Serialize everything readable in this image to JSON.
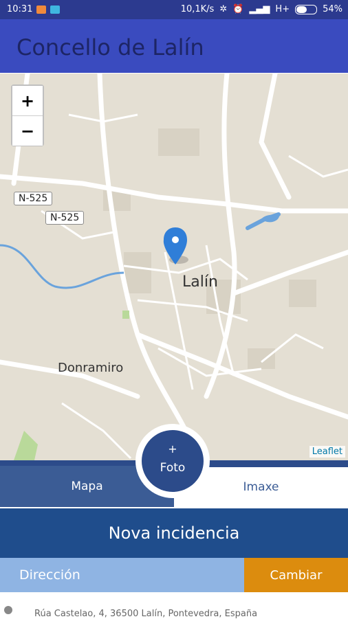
{
  "status_bar": {
    "time": "10:31",
    "net_speed": "10,1K/s",
    "network": "H+",
    "battery_percent": "54%",
    "battery_level": 0.54
  },
  "app_bar": {
    "title": "Concello de Lalín"
  },
  "map": {
    "zoom_in": "+",
    "zoom_out": "−",
    "road_labels": [
      "N-525",
      "N-525"
    ],
    "places": {
      "city": "Lalín",
      "village": "Donramiro"
    },
    "attribution": "Leaflet",
    "marker_icon": "map-marker-icon"
  },
  "tabs": {
    "map": "Mapa",
    "image": "Imaxe"
  },
  "photo_button": {
    "plus": "+",
    "label": "Foto"
  },
  "form": {
    "header": "Nova incidencia",
    "address_label": "Dirección",
    "change_button": "Cambiar",
    "address_value": "Rúa Castelao, 4, 36500 Lalín, Pontevedra, España"
  },
  "colors": {
    "status_bar": "#2c3a8f",
    "app_bar": "#3a4bbf",
    "primary": "#1f4d8c",
    "accent": "#dc8c0e",
    "marker": "#2f7ed8"
  }
}
